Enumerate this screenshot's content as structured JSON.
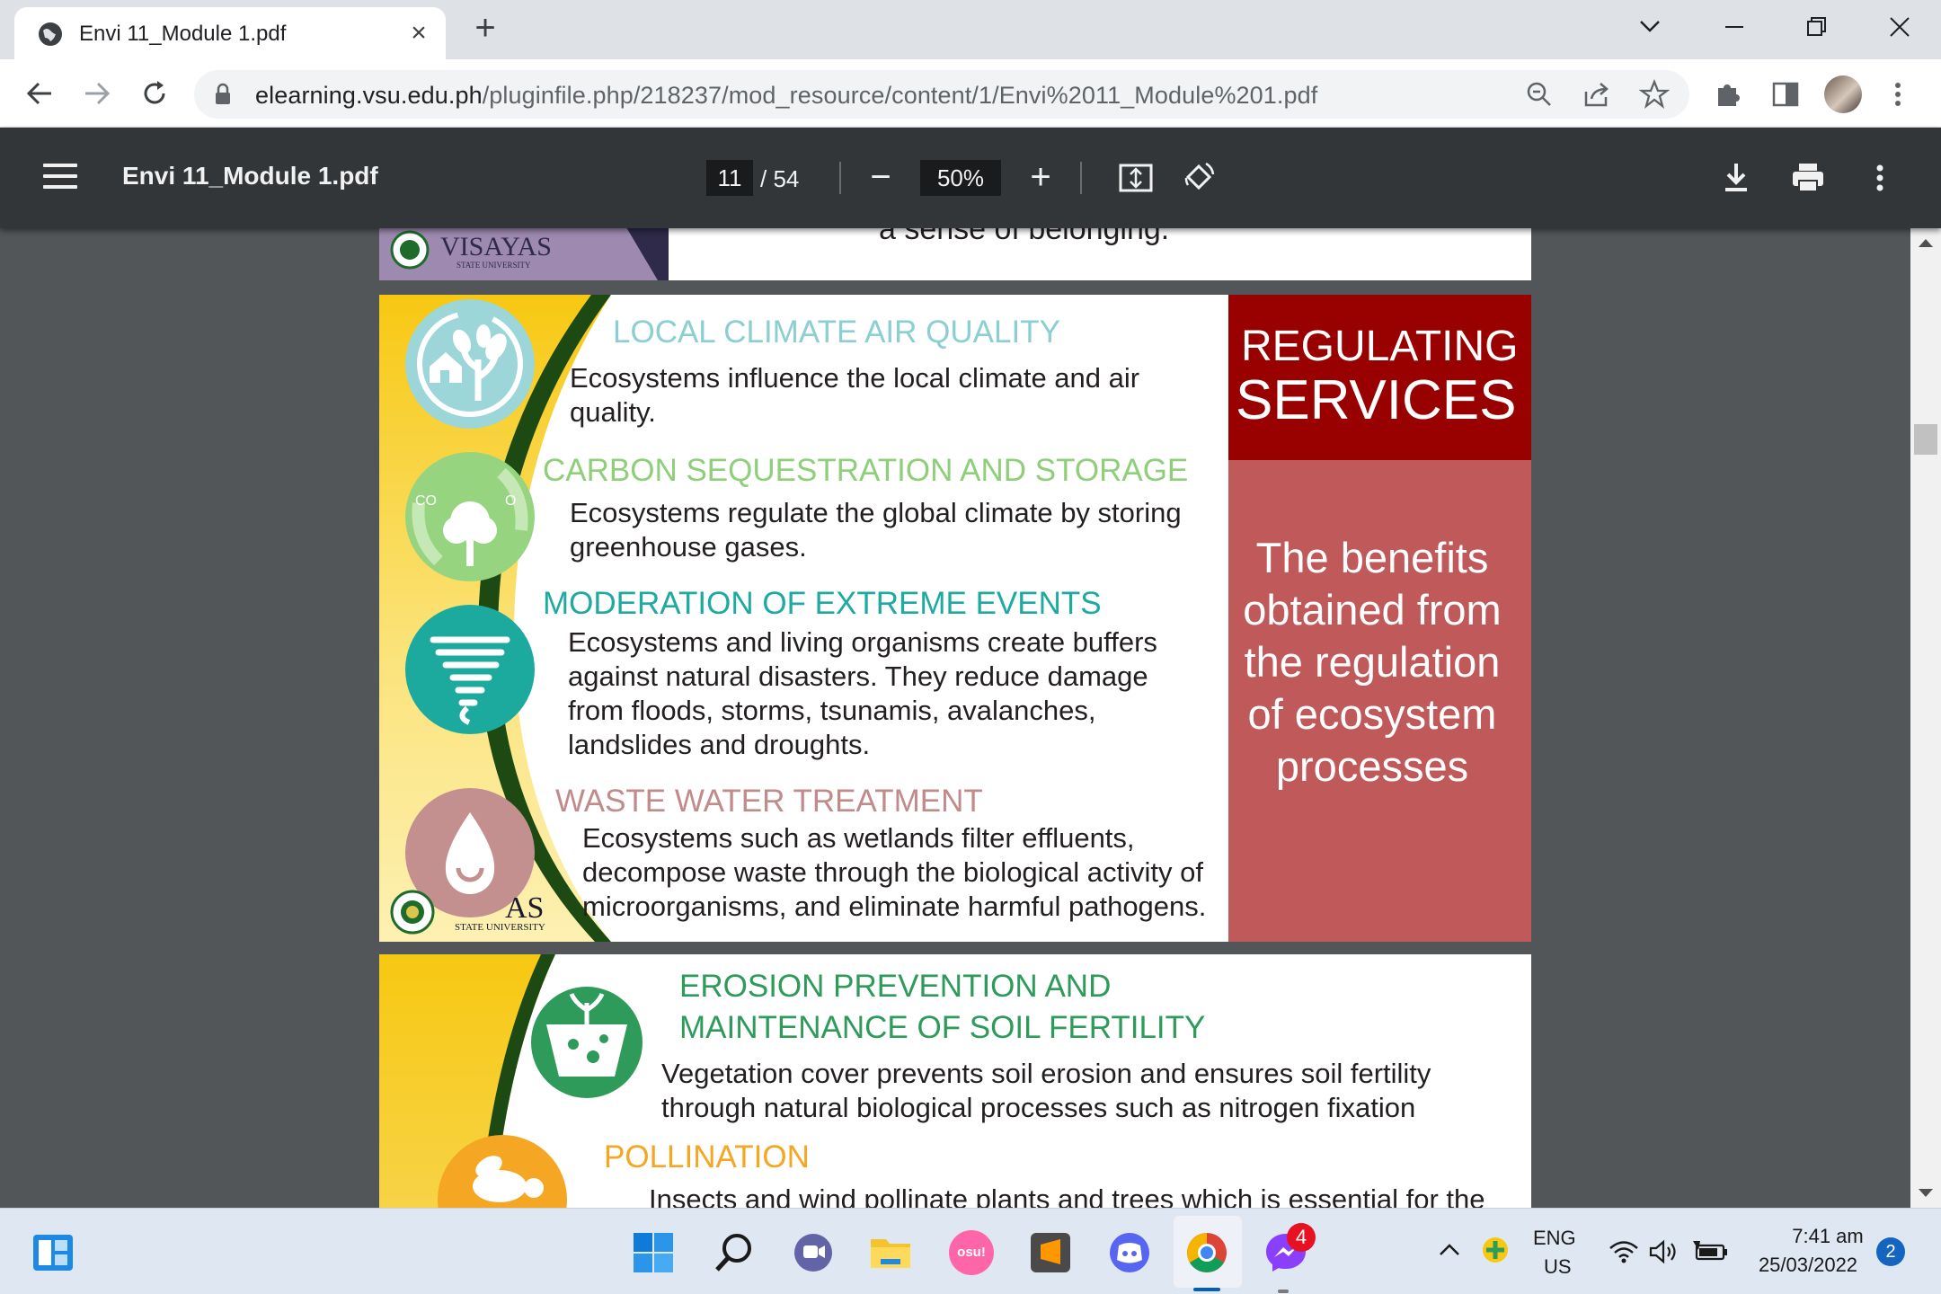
{
  "browser": {
    "tab_title": "Envi 11_Module 1.pdf",
    "tab_close": "×",
    "new_tab": "+",
    "url_domain": "elearning.vsu.edu.ph",
    "url_path": "/pluginfile.php/218237/mod_resource/content/1/Envi%2011_Module%201.pdf"
  },
  "pdf_toolbar": {
    "doc_title": "Envi 11_Module 1.pdf",
    "current_page": "11",
    "total_pages": "/ 54",
    "zoom_out": "−",
    "zoom": "50%",
    "zoom_in": "+"
  },
  "previous_slide": {
    "text": "a sense of belonging.",
    "logo_text": "VISAYAS",
    "logo_subtext": "STATE UNIVERSITY"
  },
  "slide": {
    "logo_text_partial": "AS",
    "logo_subtext": "STATE UNIVERSITY",
    "side_title_line1": "REGULATING",
    "side_title_line2": "SERVICES",
    "side_description": "The benefits obtained from the regulation of ecosystem processes",
    "services": [
      {
        "heading": "LOCAL CLIMATE AIR QUALITY",
        "body": "Ecosystems influence the local climate and air quality.",
        "color": "#8ccfd0",
        "icon": "house-tree-icon"
      },
      {
        "heading": "CARBON SEQUESTRATION AND STORAGE",
        "body": "Ecosystems regulate the global climate by storing greenhouse gases.",
        "color": "#8fcf7a",
        "icon": "co2-tree-icon",
        "icon_label_left": "CO",
        "icon_label_right": "O"
      },
      {
        "heading": "MODERATION OF EXTREME EVENTS",
        "body": "Ecosystems and living organisms create buffers against natural disasters. They reduce damage from floods, storms, tsunamis, avalanches, landslides and droughts.",
        "color": "#1eaaa0",
        "icon": "tornado-icon"
      },
      {
        "heading": "WASTE WATER TREATMENT",
        "body": "Ecosystems such as wetlands filter effluents, decompose waste through the biological activity of microorganisms, and eliminate harmful pathogens.",
        "color": "#c18b8b",
        "icon": "water-drop-icon"
      }
    ]
  },
  "next_slide": {
    "services": [
      {
        "heading_line1": "EROSION PREVENTION AND",
        "heading_line2": "MAINTENANCE OF SOIL FERTILITY",
        "body": "Vegetation cover prevents soil erosion and ensures soil fertility through natural biological processes such as nitrogen fixation",
        "color": "#2e9b5b",
        "icon": "soil-sprout-icon"
      },
      {
        "heading": "POLLINATION",
        "body": "Insects and wind pollinate plants and trees which is essential for the",
        "color": "#f5a623",
        "icon": "bee-icon"
      }
    ]
  },
  "taskbar": {
    "osu_label": "osu!",
    "notification_count": "4",
    "lang_line1": "ENG",
    "lang_line2": "US",
    "time": "7:41 am",
    "date": "25/03/2022",
    "notif_badge": "2"
  }
}
